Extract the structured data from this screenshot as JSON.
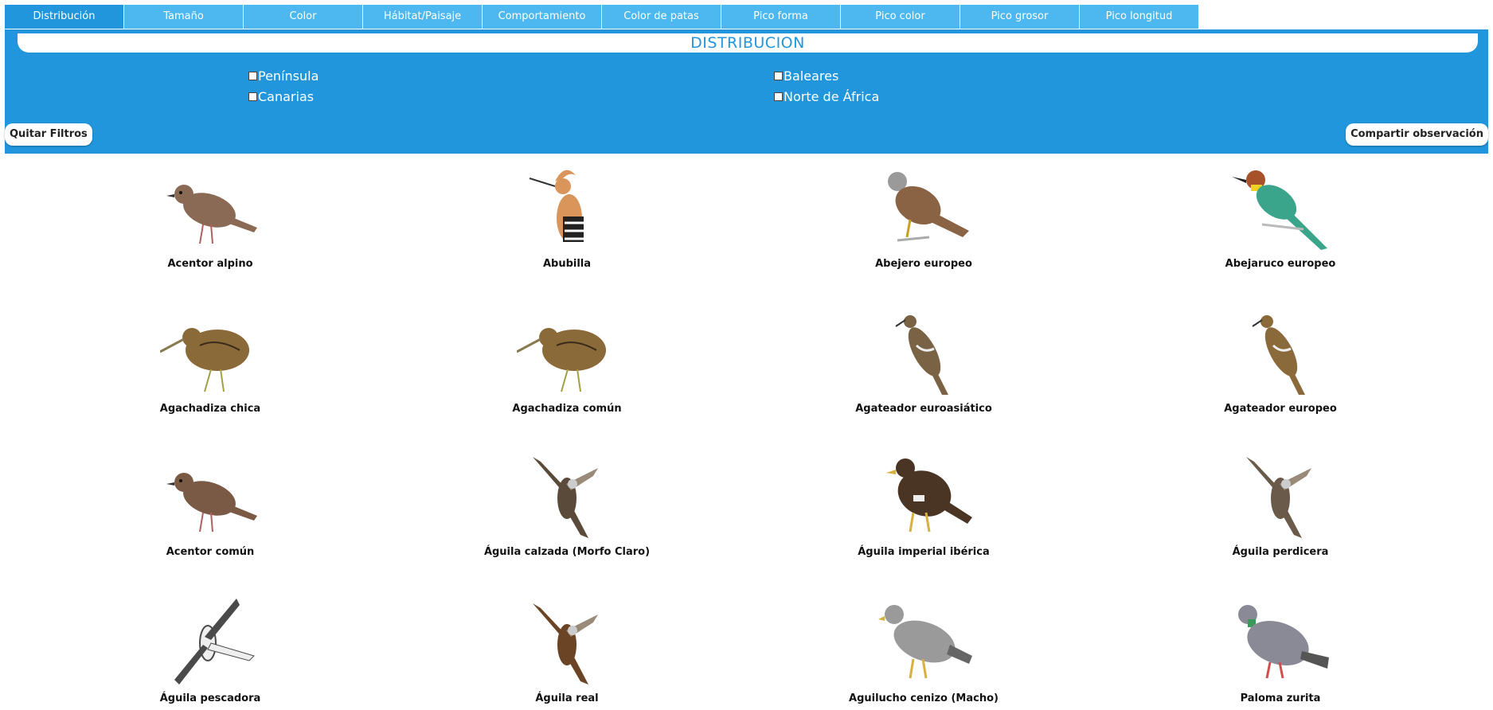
{
  "tabs": [
    {
      "label": "Distribución",
      "active": true
    },
    {
      "label": "Tamaño",
      "active": false
    },
    {
      "label": "Color",
      "active": false
    },
    {
      "label": "Hábitat/Paisaje",
      "active": false
    },
    {
      "label": "Comportamiento",
      "active": false
    },
    {
      "label": "Color de patas",
      "active": false
    },
    {
      "label": "Pico forma",
      "active": false
    },
    {
      "label": "Pico color",
      "active": false
    },
    {
      "label": "Pico grosor",
      "active": false
    },
    {
      "label": "Pico longitud",
      "active": false
    }
  ],
  "filter_panel": {
    "title": "DISTRIBUCION",
    "options": [
      {
        "label": "Península",
        "checked": false
      },
      {
        "label": "Baleares",
        "checked": false
      },
      {
        "label": "Canarias",
        "checked": false
      },
      {
        "label": "Norte de África",
        "checked": false
      }
    ],
    "clear_button": "Quitar Filtros",
    "share_button": "Compartir observación"
  },
  "birds": [
    {
      "name": "Acentor alpino",
      "icon": "sparrow-icon",
      "color": "#8a6a55"
    },
    {
      "name": "Abubilla",
      "icon": "hoopoe-icon",
      "color": "#d9955a"
    },
    {
      "name": "Abejero europeo",
      "icon": "raptor-perched-icon",
      "color": "#8a6244"
    },
    {
      "name": "Abejaruco europeo",
      "icon": "bee-eater-icon",
      "color": "#3aa58a"
    },
    {
      "name": "Agachadiza chica",
      "icon": "snipe-icon",
      "color": "#8b6a3a"
    },
    {
      "name": "Agachadiza común",
      "icon": "snipe-icon",
      "color": "#8b6a3a"
    },
    {
      "name": "Agateador euroasiático",
      "icon": "treecreeper-icon",
      "color": "#7a6244"
    },
    {
      "name": "Agateador europeo",
      "icon": "treecreeper-icon",
      "color": "#8a6a3a"
    },
    {
      "name": "Acentor común",
      "icon": "sparrow-icon",
      "color": "#7a5a44"
    },
    {
      "name": "Águila calzada (Morfo Claro)",
      "icon": "eagle-flying-icon",
      "color": "#5a4a3a"
    },
    {
      "name": "Águila imperial ibérica",
      "icon": "eagle-perched-icon",
      "color": "#4a3524"
    },
    {
      "name": "Águila perdicera",
      "icon": "eagle-flying-icon",
      "color": "#6a5a4a"
    },
    {
      "name": "Águila pescadora",
      "icon": "osprey-flying-icon",
      "color": "#4a4a4a"
    },
    {
      "name": "Águila real",
      "icon": "eagle-flying-icon",
      "color": "#6a4424"
    },
    {
      "name": "Aguilucho cenizo (Macho)",
      "icon": "harrier-perched-icon",
      "color": "#9a9a9a"
    },
    {
      "name": "Paloma zurita",
      "icon": "pigeon-icon",
      "color": "#8a8a96"
    }
  ]
}
